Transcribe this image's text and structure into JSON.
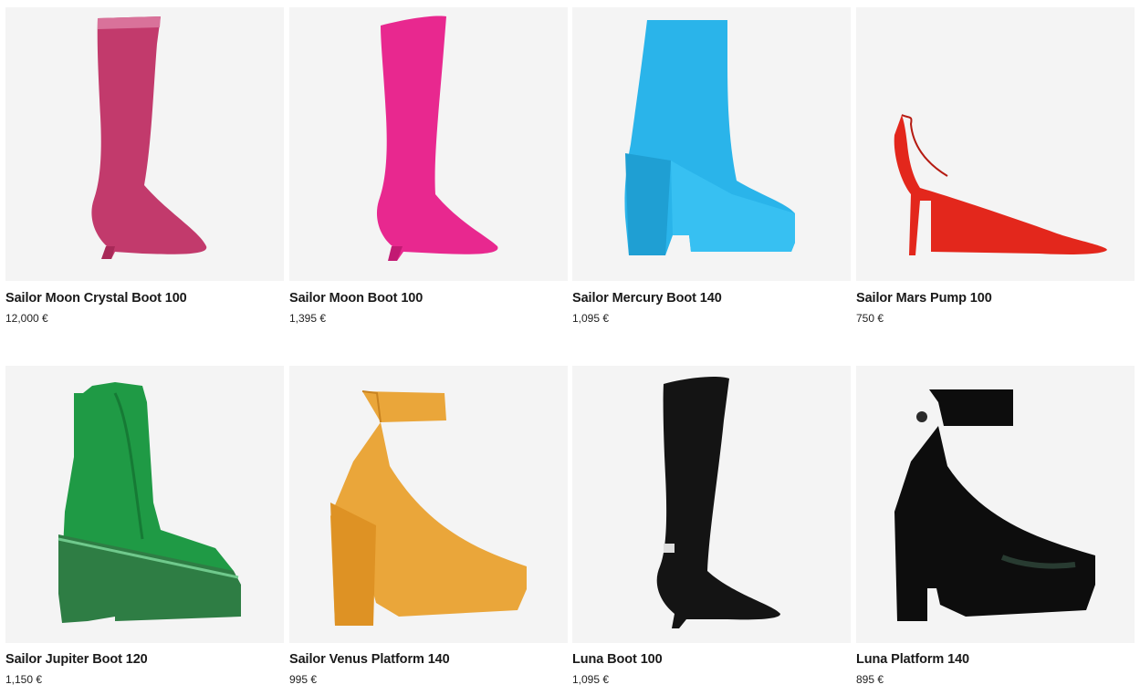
{
  "products": [
    {
      "name": "Sailor Moon Crystal Boot 100",
      "price": "12,000 €",
      "color": "#c23a6c",
      "image": "pink-crystal-knee-boot"
    },
    {
      "name": "Sailor Moon Boot 100",
      "price": "1,395 €",
      "color": "#e8288f",
      "image": "fuchsia-knee-boot"
    },
    {
      "name": "Sailor Mercury Boot 140",
      "price": "1,095 €",
      "color": "#2ab4ea",
      "image": "blue-patent-platform-ankle-boot"
    },
    {
      "name": "Sailor Mars Pump 100",
      "price": "750 €",
      "color": "#e3271c",
      "image": "red-patent-pump"
    },
    {
      "name": "Sailor Jupiter Boot 120",
      "price": "1,150 €",
      "color": "#1f9a45",
      "image": "green-lace-up-platform-boot"
    },
    {
      "name": "Sailor Venus Platform 140",
      "price": "995 €",
      "color": "#eaa63a",
      "image": "orange-studded-platform-pump"
    },
    {
      "name": "Luna Boot 100",
      "price": "1,095 €",
      "color": "#141414",
      "image": "black-knee-boot"
    },
    {
      "name": "Luna Platform 140",
      "price": "895 €",
      "color": "#0d0d0d",
      "image": "black-patent-ankle-strap-platform"
    }
  ]
}
